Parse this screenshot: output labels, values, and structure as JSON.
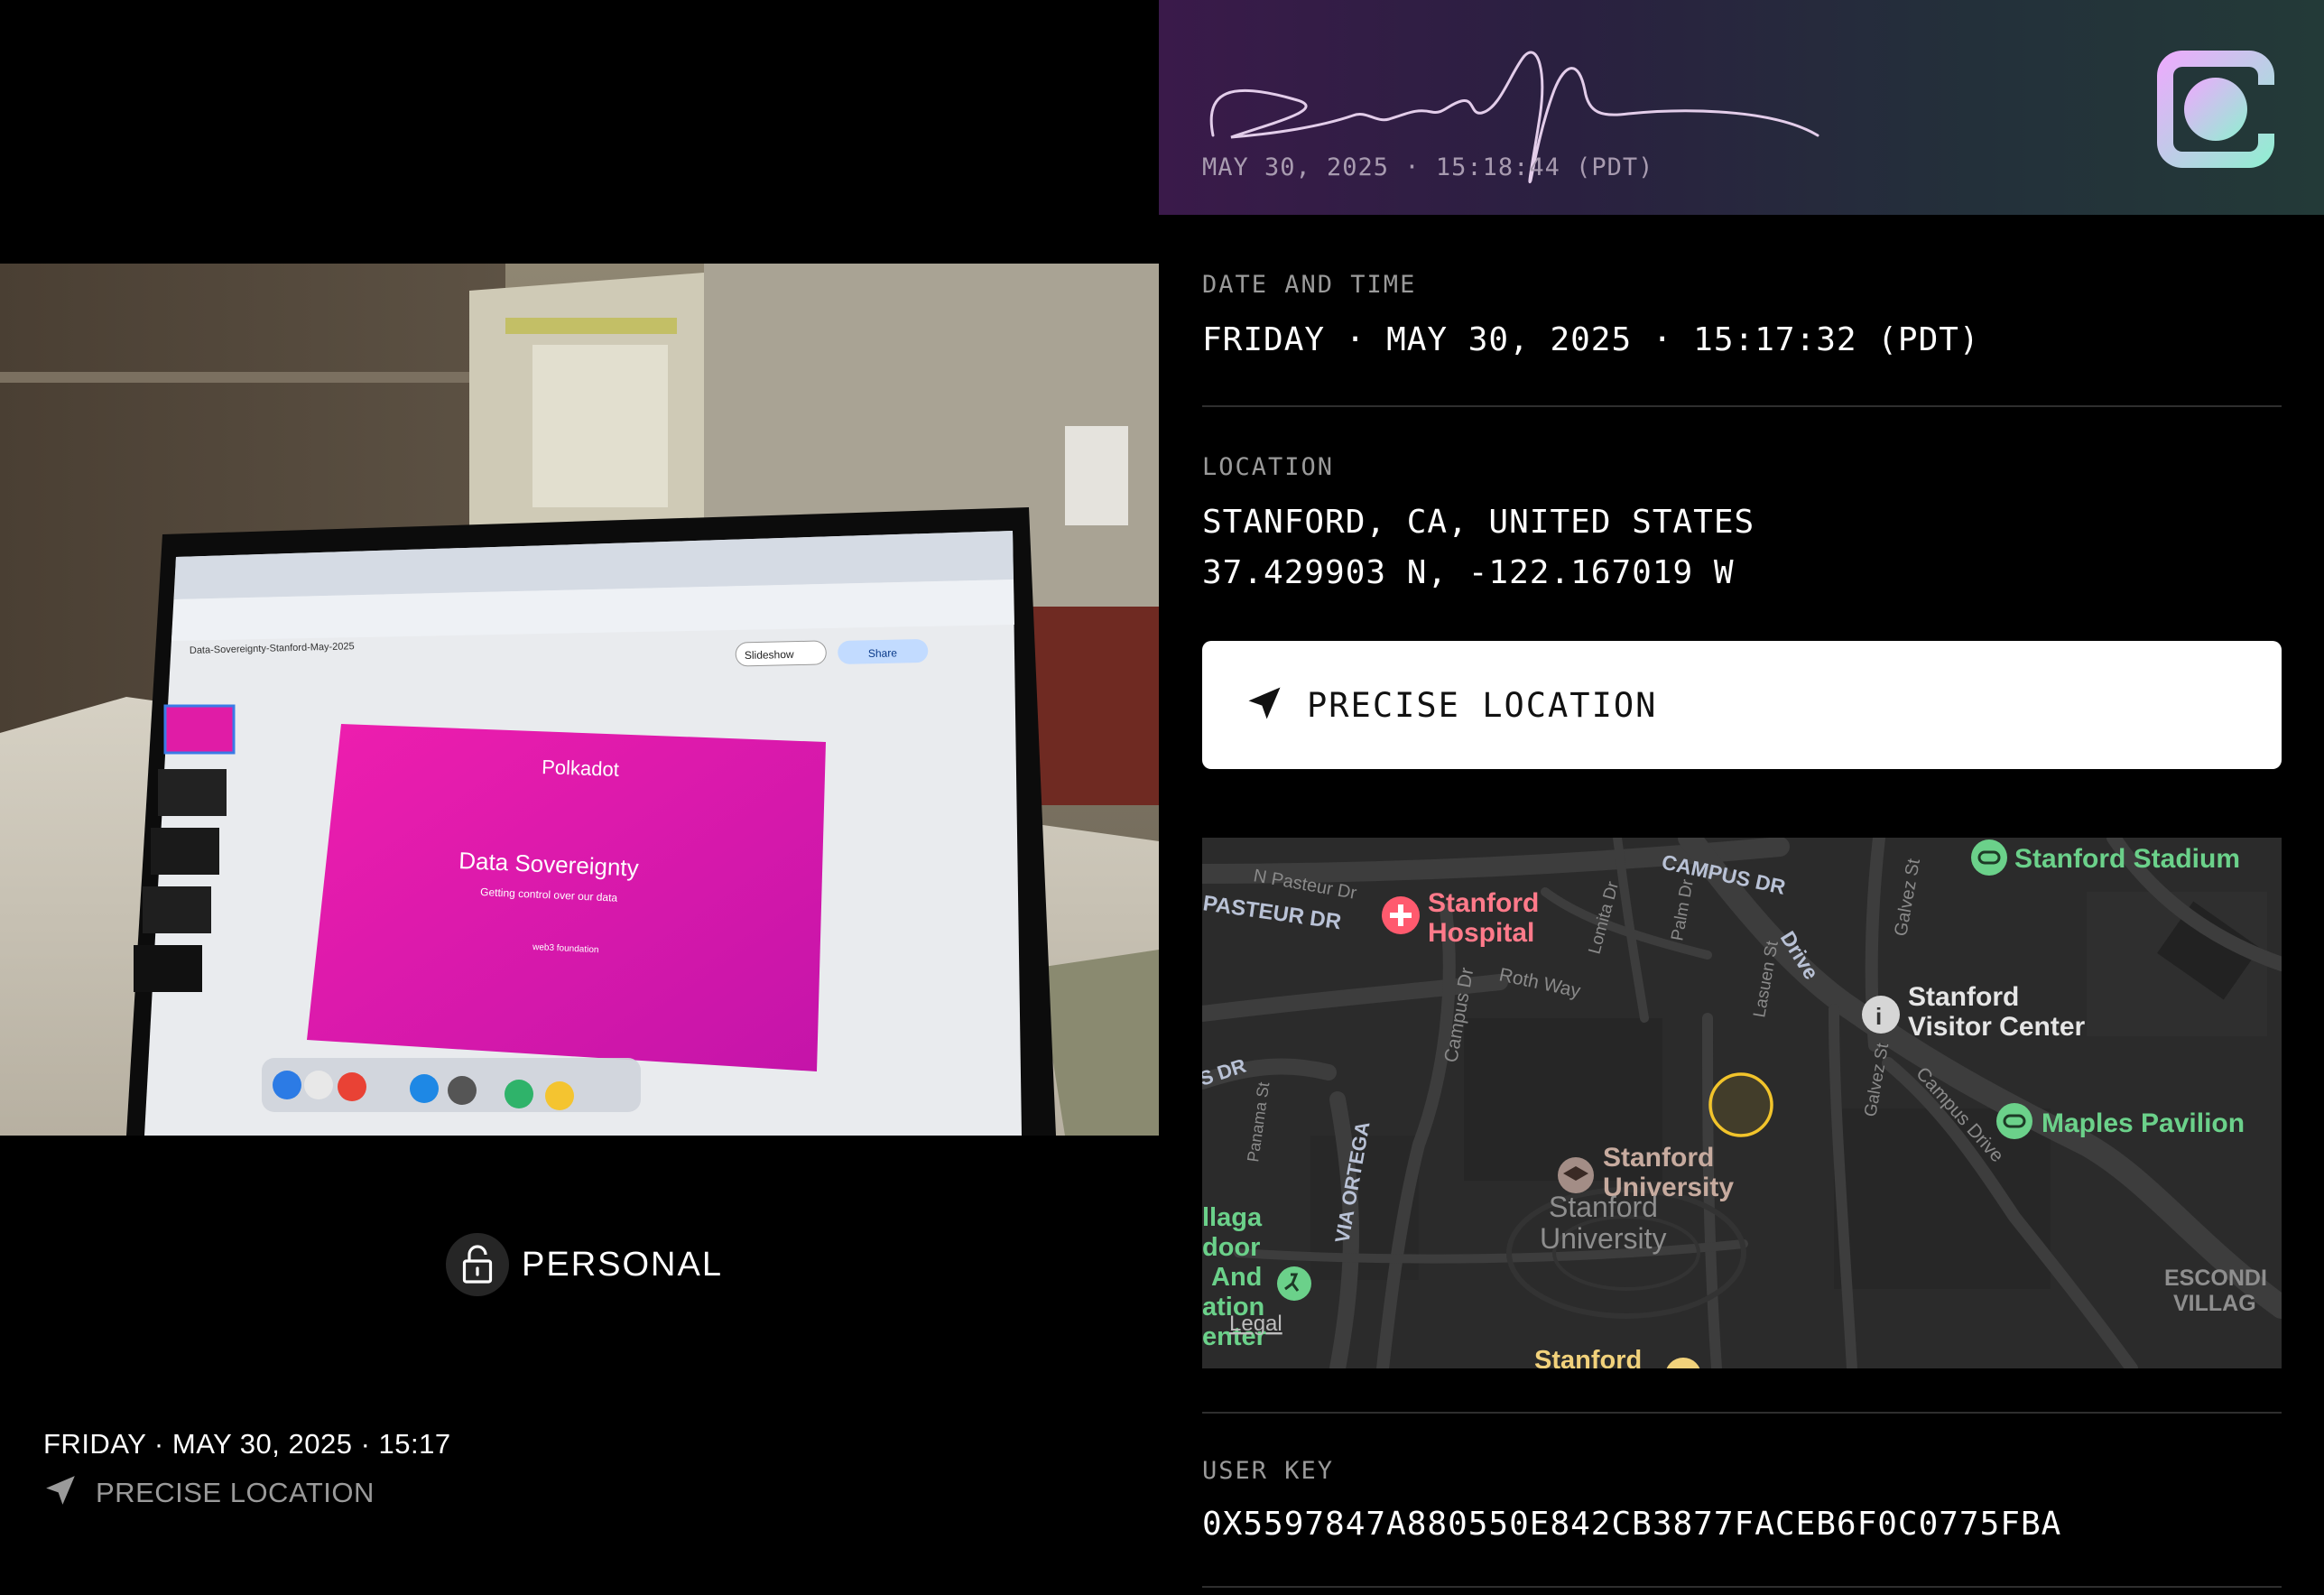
{
  "signature_banner": {
    "timestamp": "MAY 30, 2025 · 15:18:44 (PDT)",
    "logo_icon": "brand-logo-icon",
    "signature_icon": "handwritten-signature"
  },
  "photo": {
    "slide_brand": "Polkadot",
    "slide_title": "Data Sovereignty",
    "slide_subtitle": "Getting control over our data",
    "slide_footer": "web3 foundation",
    "doc_title": "Data-Sovereignty-Stanford-May-2025",
    "slideshow_label": "Slideshow",
    "share_label": "Share"
  },
  "privacy": {
    "label": "PERSONAL",
    "icon": "unlock-icon"
  },
  "caption": {
    "datetime": "FRIDAY · MAY 30, 2025 · 15:17",
    "location_label": "PRECISE LOCATION",
    "location_icon": "navigation-arrow-icon"
  },
  "details": {
    "date_label": "DATE AND TIME",
    "date_value": "FRIDAY · MAY 30, 2025 · 15:17:32 (PDT)",
    "location_label": "LOCATION",
    "location_place": "STANFORD, CA, UNITED STATES",
    "location_coords": "37.429903 N, -122.167019 W",
    "precise_button": "PRECISE LOCATION",
    "user_key_label": "USER KEY",
    "user_key_value": "0X5597847A880550E842CB3877FACEB6F0C0775FBA"
  },
  "map": {
    "legal": "Legal",
    "pois": {
      "stadium": "Stanford Stadium",
      "hospital_1": "Stanford",
      "hospital_2": "Hospital",
      "visitor_1": "Stanford",
      "visitor_2": "Visitor Center",
      "maples": "Maples Pavilion",
      "univ_1": "Stanford",
      "univ_2": "University",
      "univ_area_1": "Stanford",
      "univ_area_2": "University",
      "stanford_bottom": "Stanford",
      "escondido_1": "ESCONDI",
      "escondido_2": "VILLAG",
      "village_1": "llaga",
      "village_2": "door",
      "village_3": "And",
      "village_4": "ation",
      "village_5": "enter"
    },
    "streets": {
      "campus_dr": "CAMPUS DR",
      "drive": "Drive",
      "pasteur": "PASTEUR DR",
      "n_pasteur": "N Pasteur Dr",
      "lomita": "Lomita Dr",
      "palm": "Palm Dr",
      "roth": "Roth Way",
      "campus_dr_small": "Campus Dr",
      "lasuen": "Lasuen St",
      "galvez_top": "Galvez St",
      "galvez_mid": "Galvez St",
      "campus_drive_right": "Campus Drive",
      "s_dr": "S DR",
      "panama": "Panama St",
      "via_ortega": "VIA ORTEGA"
    },
    "colors": {
      "background": "#2b2b2b",
      "road": "#3d3d3d",
      "green_poi": "#6bd18a",
      "red_poi": "#ff7a8a",
      "marker": "#f2c42b"
    }
  }
}
